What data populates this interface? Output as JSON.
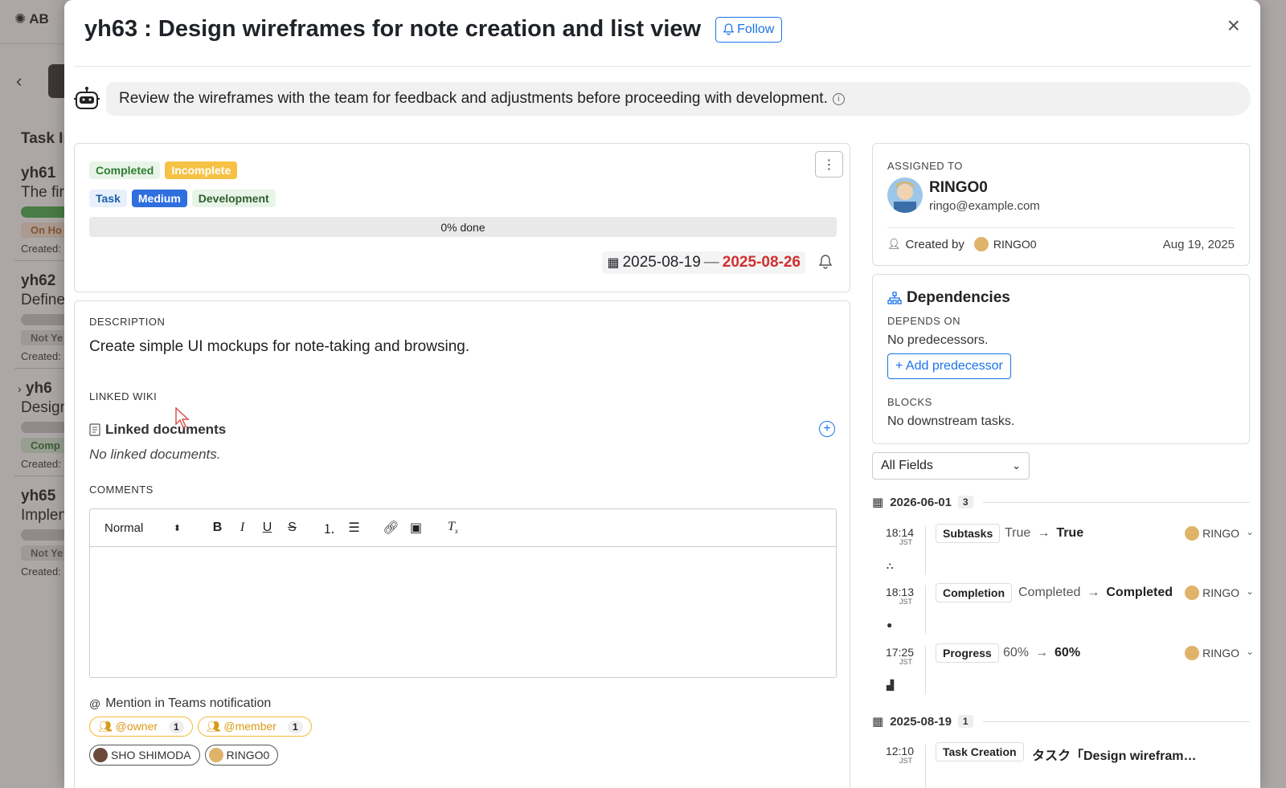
{
  "background_app": {
    "logo": "AB",
    "section_title": "Task In",
    "tasks": [
      {
        "id": "yh61",
        "title": "The fir",
        "status": "On Ho",
        "created": "Created:"
      },
      {
        "id": "yh62",
        "title": "Define",
        "status": "Not Ye",
        "created": "Created:"
      },
      {
        "id": "yh6",
        "title": "Design",
        "status": "Comp",
        "created": "Created:"
      },
      {
        "id": "yh65",
        "title": "Implen",
        "status": "Not Ye",
        "created": "Created:"
      }
    ]
  },
  "header": {
    "title": "yh63 : Design wireframes for note creation and list view",
    "follow_label": "Follow",
    "close_icon": "×"
  },
  "ai_summary": {
    "text": "Review the wireframes with the team for feedback and adjustments before proceeding with development.",
    "info_icon": "i"
  },
  "status_card": {
    "statuses": [
      "Completed",
      "Incomplete"
    ],
    "tags": [
      "Task",
      "Medium",
      "Development"
    ],
    "progress_label": "0% done",
    "progress_value": 0,
    "start_date": "2025-08-19",
    "date_separator": "—",
    "end_date": "2025-08-26"
  },
  "description": {
    "label": "DESCRIPTION",
    "text": "Create simple UI mockups for note-taking and browsing."
  },
  "linked_wiki": {
    "label": "LINKED WIKI",
    "title": "Linked documents",
    "empty": "No linked documents."
  },
  "comments": {
    "label": "COMMENTS",
    "format_select": "Normal",
    "mention_label": "Mention in Teams notification",
    "roles": [
      {
        "label": "@owner",
        "count": "1"
      },
      {
        "label": "@member",
        "count": "1"
      }
    ],
    "users": [
      "SHO SHIMODA",
      "RINGO0"
    ]
  },
  "assignment": {
    "label": "ASSIGNED TO",
    "name": "RINGO0",
    "email": "ringo@example.com",
    "created_by_label": "Created by",
    "created_by": "RINGO0",
    "created_date": "Aug 19, 2025"
  },
  "dependencies": {
    "title": "Dependencies",
    "depends_on_label": "DEPENDS ON",
    "depends_on_empty": "No predecessors.",
    "add_label": "Add predecessor",
    "blocks_label": "BLOCKS",
    "blocks_empty": "No downstream tasks."
  },
  "history": {
    "filter": "All Fields",
    "groups": [
      {
        "date": "2026-06-01",
        "count": "3",
        "entries": [
          {
            "time": "18:14",
            "tz": "JST",
            "field": "Subtasks",
            "from": "True",
            "to": "True",
            "user": "RINGO"
          },
          {
            "time": "18:13",
            "tz": "JST",
            "field": "Completion",
            "from": "Completed",
            "to": "Completed",
            "user": "RINGO"
          },
          {
            "time": "17:25",
            "tz": "JST",
            "field": "Progress",
            "from": "60%",
            "to": "60%",
            "user": "RINGO"
          }
        ]
      },
      {
        "date": "2025-08-19",
        "count": "1",
        "entries": [
          {
            "time": "12:10",
            "tz": "JST",
            "field": "Task Creation",
            "text": "タスク「Design wirefram…"
          }
        ]
      }
    ]
  }
}
